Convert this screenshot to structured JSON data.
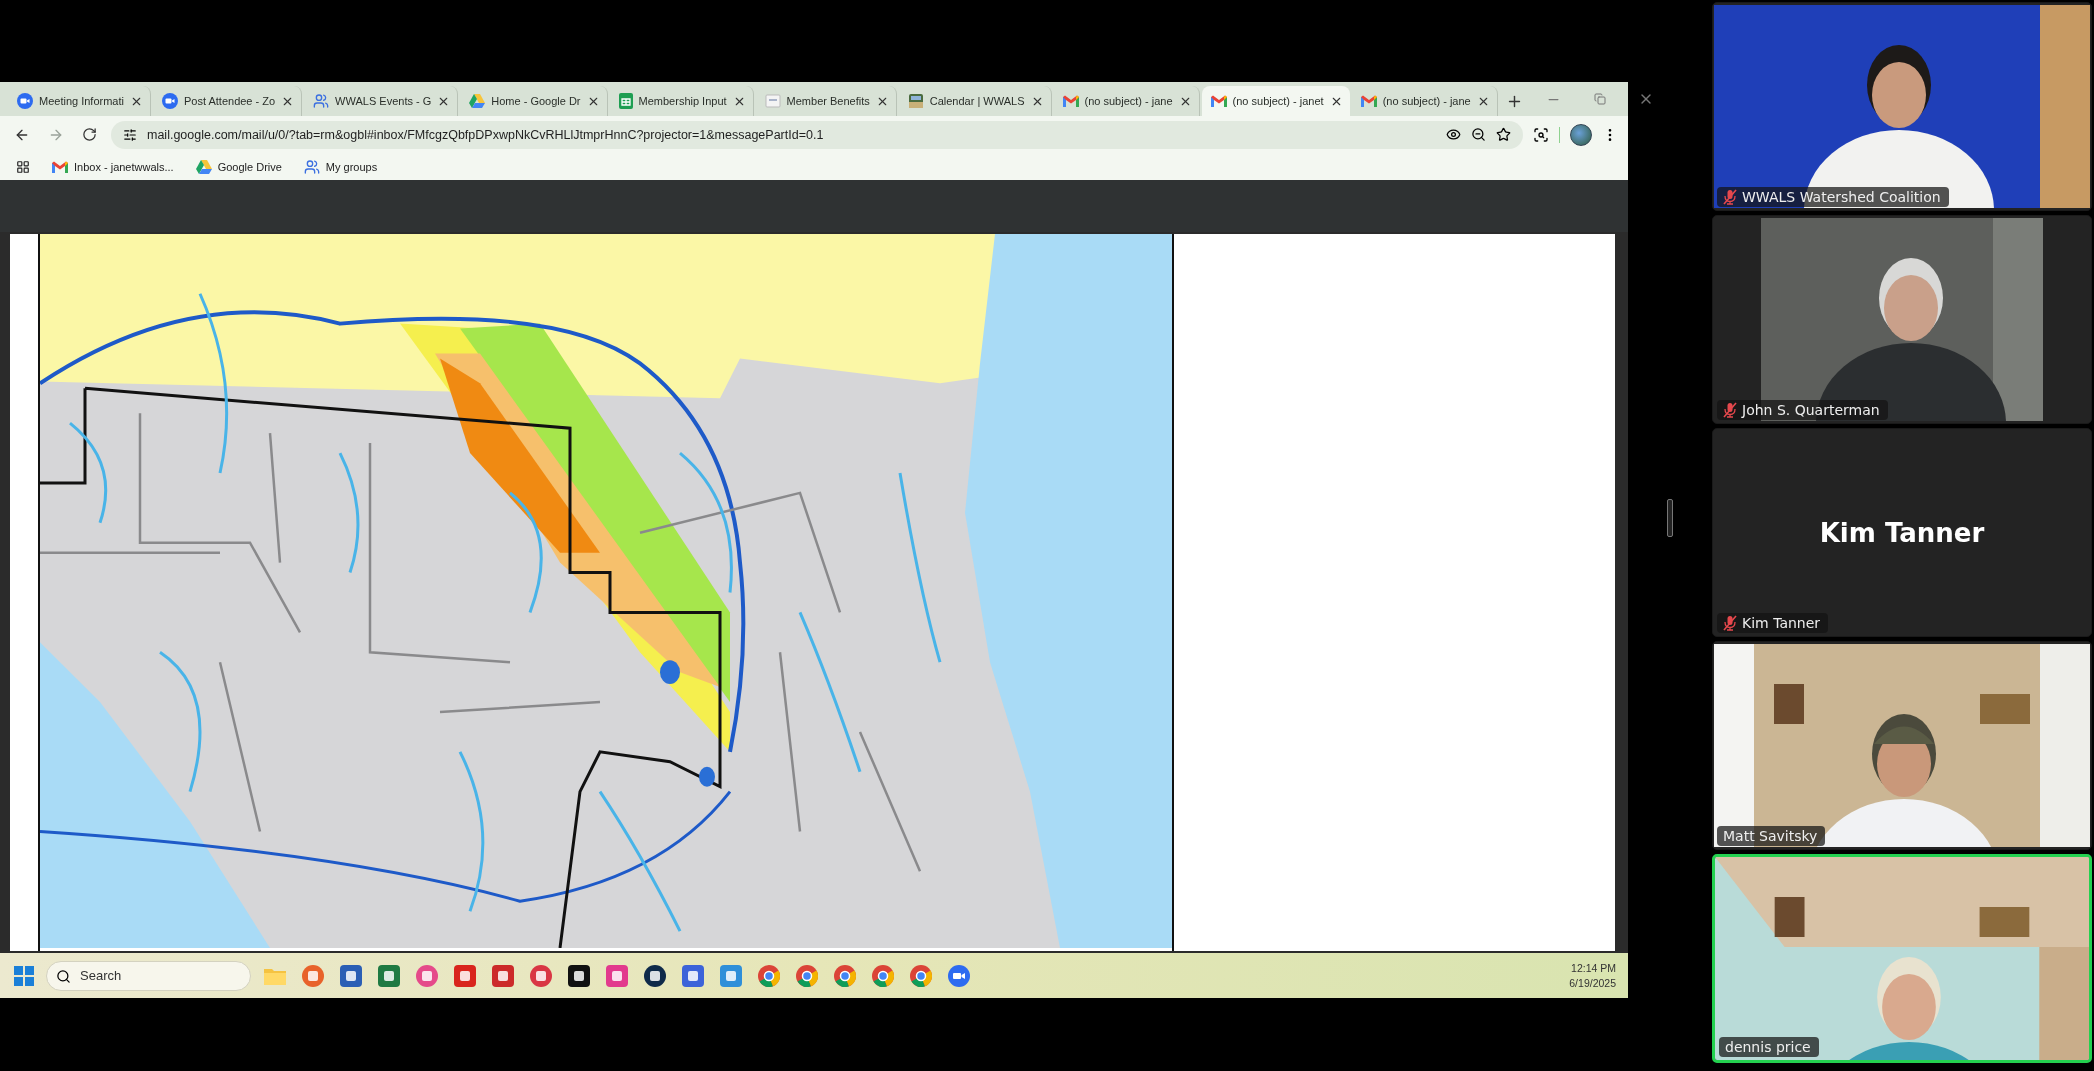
{
  "browser": {
    "tabs": [
      {
        "title": "Meeting Informati",
        "selected": false
      },
      {
        "title": "Post Attendee - Zo",
        "selected": false
      },
      {
        "title": "WWALS Events - G",
        "selected": false
      },
      {
        "title": "Home - Google Dr",
        "selected": false
      },
      {
        "title": "Membership Input",
        "selected": false
      },
      {
        "title": "Member Benefits",
        "selected": false
      },
      {
        "title": "Calendar | WWALS",
        "selected": false
      },
      {
        "title": "(no subject) - jane",
        "selected": false
      },
      {
        "title": "(no subject) - janet",
        "selected": true
      },
      {
        "title": "(no subject) - jane",
        "selected": false
      }
    ],
    "address": "mail.google.com/mail/u/0/?tab=rm&ogbl#inbox/FMfcgzQbfpDPxwpNkCvRHLlJtmprHnnC?projector=1&messagePartId=0.1",
    "bookmarks": [
      {
        "label": "Inbox - janetwwals..."
      },
      {
        "label": "Google Drive"
      },
      {
        "label": "My groups"
      }
    ]
  },
  "taskbar": {
    "search": {
      "placeholder": "Search"
    },
    "time": "12:14 PM",
    "date": "6/19/2025"
  },
  "participants": [
    {
      "name": "WWALS Watershed Coalition",
      "muted": true,
      "camera_on": true,
      "speaking": false
    },
    {
      "name": "John S. Quarterman",
      "muted": true,
      "camera_on": true,
      "speaking": false
    },
    {
      "name": "Kim Tanner",
      "avatar_name": "Kim Tanner",
      "muted": true,
      "camera_on": false,
      "speaking": false
    },
    {
      "name": "Matt Savitsky",
      "muted": false,
      "camera_on": true,
      "speaking": false
    },
    {
      "name": "dennis price",
      "muted": false,
      "camera_on": true,
      "speaking": true
    }
  ]
}
